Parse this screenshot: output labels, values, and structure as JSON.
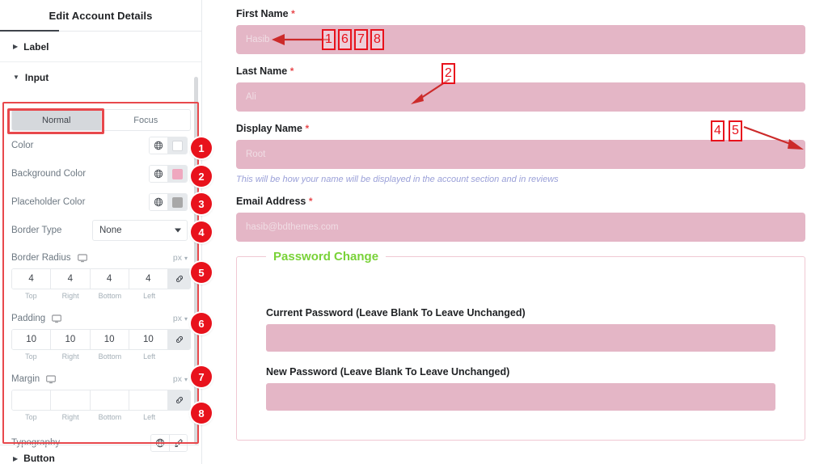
{
  "panel": {
    "title": "Edit Account Details",
    "sections": [
      {
        "name": "Label",
        "caret": "caret-right-icon",
        "open": false
      },
      {
        "name": "Input",
        "caret": "caret-down-icon",
        "open": true
      },
      {
        "name": "Button",
        "caret": "caret-right-icon",
        "open": false
      }
    ],
    "state_tabs": [
      {
        "label": "Normal",
        "active": true
      },
      {
        "label": "Focus",
        "active": false
      }
    ],
    "controls": {
      "color": {
        "label": "Color",
        "globe": "globe-icon",
        "swatch": "#ffffff"
      },
      "background_color": {
        "label": "Background Color",
        "globe": "globe-icon",
        "swatch": "#efa8bf"
      },
      "placeholder_color": {
        "label": "Placeholder Color",
        "globe": "globe-icon",
        "swatch": "#a8a8a8"
      },
      "border_type": {
        "label": "Border Type",
        "value": "None",
        "caret": "chevron-down-icon"
      },
      "border_radius": {
        "label": "Border Radius",
        "device": "monitor-icon",
        "unit": "px",
        "unit_caret": "chevron-down-icon",
        "values": [
          "4",
          "4",
          "4",
          "4"
        ],
        "sides": [
          "Top",
          "Right",
          "Bottom",
          "Left"
        ],
        "link": "link-icon"
      },
      "padding": {
        "label": "Padding",
        "device": "monitor-icon",
        "unit": "px",
        "unit_caret": "chevron-down-icon",
        "values": [
          "10",
          "10",
          "10",
          "10"
        ],
        "sides": [
          "Top",
          "Right",
          "Bottom",
          "Left"
        ],
        "link": "link-icon"
      },
      "margin": {
        "label": "Margin",
        "device": "monitor-icon",
        "unit": "px",
        "unit_caret": "chevron-down-icon",
        "values": [
          "",
          "",
          "",
          ""
        ],
        "sides": [
          "Top",
          "Right",
          "Bottom",
          "Left"
        ],
        "link": "link-icon"
      },
      "typography": {
        "label": "Typography",
        "globe": "globe-icon",
        "edit": "pencil-icon"
      }
    }
  },
  "preview": {
    "fields": [
      {
        "label": "First Name",
        "required": "*",
        "placeholder": "Hasib",
        "helper": ""
      },
      {
        "label": "Last Name",
        "required": "*",
        "placeholder": "Ali",
        "helper": ""
      },
      {
        "label": "Display Name",
        "required": "*",
        "placeholder": "Root",
        "helper": "This will be how your name will be displayed in the account section and in reviews"
      },
      {
        "label": "Email Address",
        "required": "*",
        "placeholder": "hasib@bdthemes.com",
        "helper": ""
      }
    ],
    "password_section": {
      "legend": "Password Change",
      "fields": [
        {
          "label": "Current Password (Leave Blank To Leave Unchanged)",
          "value": ""
        },
        {
          "label": "New Password (Leave Blank To Leave Unchanged)",
          "value": ""
        }
      ]
    }
  },
  "annotations": {
    "panel_badges": [
      "1",
      "2",
      "3",
      "4",
      "5",
      "6",
      "7",
      "8"
    ],
    "preview_boxes_group_a": [
      "1",
      "6",
      "7",
      "8"
    ],
    "preview_box_b": "2",
    "preview_boxes_group_c": [
      "4",
      "5"
    ]
  },
  "colors": {
    "accent_red": "#e8121c",
    "highlight_red": "#e8484c",
    "field_pink": "#e4b6c6",
    "legend_green": "#79d238",
    "helper_purple": "#9aa0d8"
  }
}
